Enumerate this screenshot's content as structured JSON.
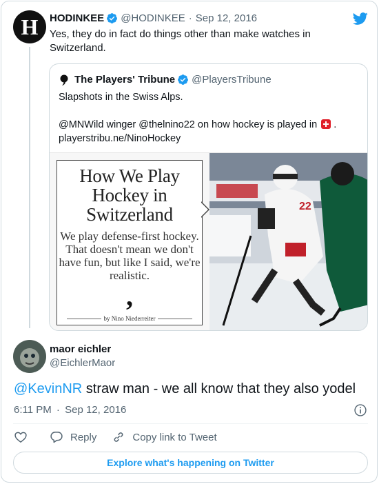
{
  "parent_tweet": {
    "avatar_letter": "H",
    "name": "HODINKEE",
    "handle": "@HODINKEE",
    "separator": "·",
    "date": "Sep 12, 2016",
    "text": "Yes, they do in fact do things other than make watches in Switzerland."
  },
  "quoted_tweet": {
    "name": "The Players' Tribune",
    "handle": "@PlayersTribune",
    "line1": "Slapshots in the Swiss Alps.",
    "line2_text": "@MNWild winger @thelnino22 on how hockey is played in",
    "line2_end": ".",
    "link": "playerstribu.ne/NinoHockey",
    "card": {
      "title": "How We Play Hockey in Switzerland",
      "subtitle": "We play defense-first hockey. That doesn't mean we don't have fun, but like I said, we're realistic.",
      "comma": ",",
      "byline": "by Nino Niederreiter"
    }
  },
  "reply_tweet": {
    "name": "maor eichler",
    "handle": "@EichlerMaor",
    "mention": "@KevinNR",
    "text": " straw man - we all know that they also yodel",
    "time": "6:11 PM",
    "separator": "·",
    "date": "Sep 12, 2016"
  },
  "actions": {
    "reply": "Reply",
    "copy_link": "Copy link to Tweet"
  },
  "explore_label": "Explore what's happening on Twitter",
  "colors": {
    "twitter_blue": "#1d9bf0",
    "text": "#0f1419",
    "muted": "#536471",
    "border": "#cfd9de",
    "swiss_red": "#e0202a"
  },
  "icons": [
    "hodinkee-avatar",
    "verified-icon",
    "twitter-bird-icon",
    "players-tribune-logo-icon",
    "swiss-flag-icon",
    "info-icon",
    "heart-icon",
    "reply-icon",
    "link-icon"
  ]
}
